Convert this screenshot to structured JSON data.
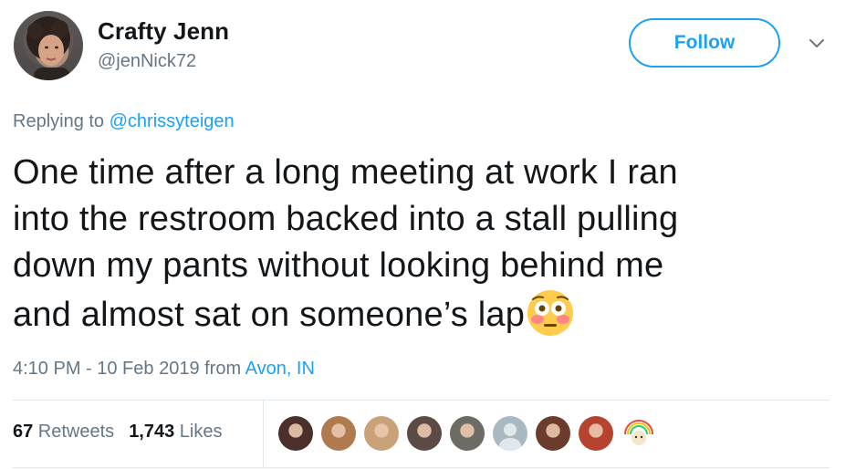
{
  "user": {
    "name": "Crafty Jenn",
    "handle": "@jenNick72"
  },
  "follow_label": "Follow",
  "reply": {
    "prefix": "Replying to",
    "mention": "@chrissyteigen"
  },
  "tweet": {
    "line1": "One time after a long meeting at work I ran",
    "line2": "into the restroom backed into a stall pulling",
    "line3": "down my pants without looking behind me",
    "line4": "and almost sat on someone’s lap",
    "emoji": "flushed-face-emoji"
  },
  "meta": {
    "time": "4:10 PM - 10 Feb 2019 from ",
    "location": "Avon, IN"
  },
  "stats": {
    "retweets_count": "67",
    "retweets_label": " Retweets",
    "likes_count": "1,743",
    "likes_label": " Likes"
  },
  "likers": [
    {
      "name": "liker-avatar-1",
      "color": "#4a2f2a"
    },
    {
      "name": "liker-avatar-2",
      "color": "#b07a4f"
    },
    {
      "name": "liker-avatar-3",
      "color": "#c9a27a"
    },
    {
      "name": "liker-avatar-4",
      "color": "#5b4b44"
    },
    {
      "name": "liker-avatar-5",
      "color": "#6e6a66"
    },
    {
      "name": "liker-avatar-6",
      "color": "#aab8c2"
    },
    {
      "name": "liker-avatar-7",
      "color": "#6b3b2c"
    },
    {
      "name": "liker-avatar-8",
      "color": "#b5432f"
    },
    {
      "name": "liker-avatar-9",
      "color": "#f3efe6"
    }
  ],
  "colors": {
    "accent": "#1da1f2",
    "muted": "#657786",
    "text": "#14171a",
    "border": "#e1e8ed"
  }
}
